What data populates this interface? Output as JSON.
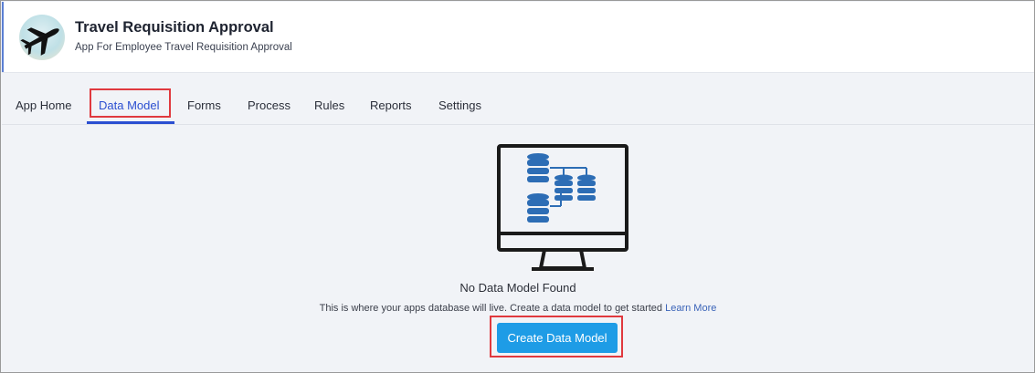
{
  "app": {
    "title": "Travel Requisition Approval",
    "subtitle": "App For Employee Travel Requisition Approval",
    "logo_icon": "airplane-icon"
  },
  "tabs": [
    {
      "label": "App Home",
      "active": false
    },
    {
      "label": "Data Model",
      "active": true
    },
    {
      "label": "Forms",
      "active": false
    },
    {
      "label": "Process",
      "active": false
    },
    {
      "label": "Rules",
      "active": false
    },
    {
      "label": "Reports",
      "active": false
    },
    {
      "label": "Settings",
      "active": false
    }
  ],
  "empty_state": {
    "illustration": "monitor-database-icon",
    "title": "No Data Model Found",
    "description": "This is where your apps database will live. Create a data model to get started",
    "link_label": "Learn More",
    "button_label": "Create Data Model"
  },
  "colors": {
    "accent": "#2b4fd1",
    "button": "#1e9ce6",
    "highlight": "#e0393e",
    "database": "#2d6db5"
  }
}
